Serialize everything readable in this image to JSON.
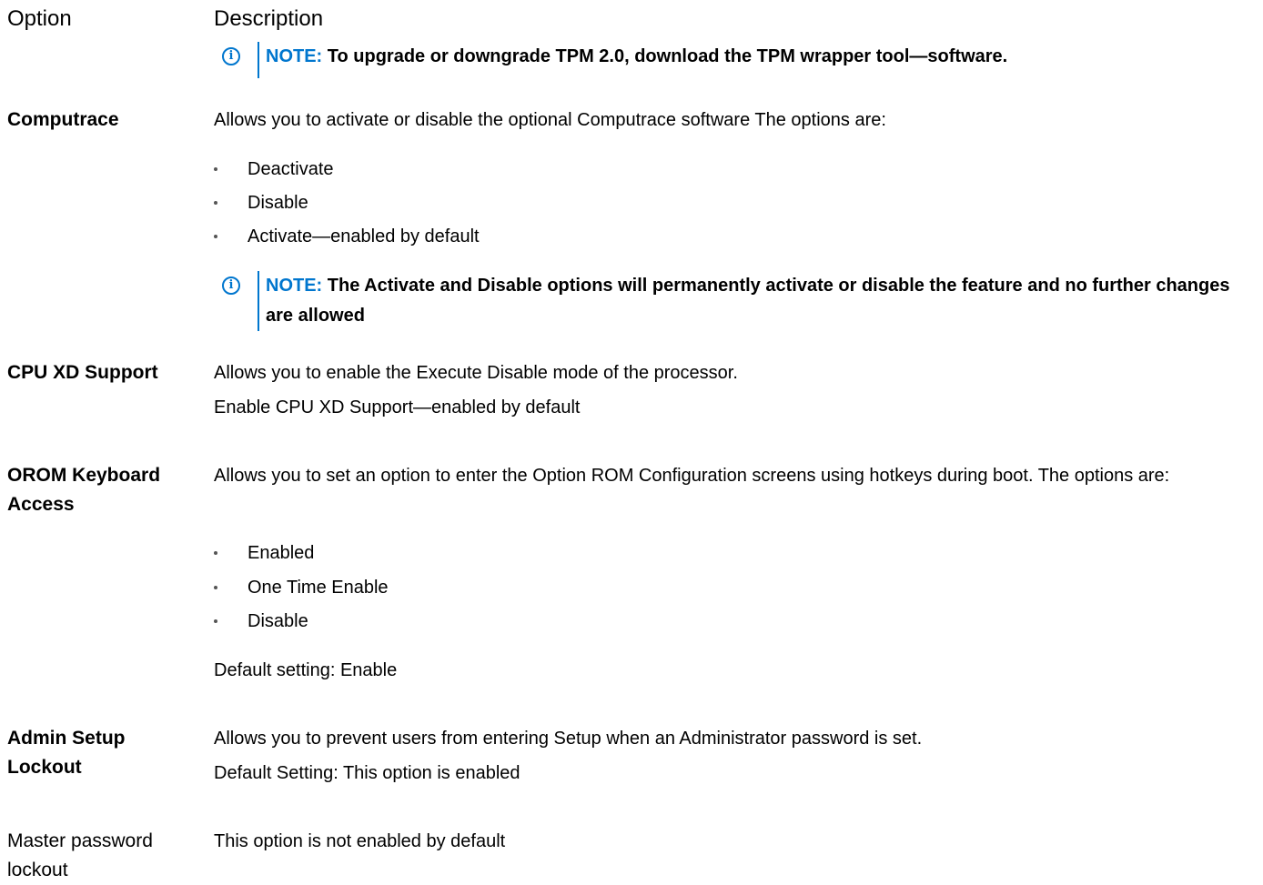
{
  "header": {
    "option": "Option",
    "description": "Description"
  },
  "note_tpm": {
    "label": "NOTE:",
    "text": " To upgrade or downgrade TPM 2.0, download the TPM wrapper tool—software."
  },
  "rows": [
    {
      "option": "Computrace",
      "intro": "Allows you to activate or disable the optional Computrace software The options are:",
      "items": [
        "Deactivate",
        "Disable",
        "Activate—enabled by default"
      ],
      "note": {
        "label": "NOTE:",
        "text": " The Activate and Disable options will permanently activate or disable the feature and no further changes are allowed"
      }
    },
    {
      "option": "CPU XD Support",
      "lines": [
        "Allows you to enable the Execute Disable mode of the processor.",
        "Enable CPU XD Support—enabled by default"
      ]
    },
    {
      "option": "OROM Keyboard Access",
      "intro": "Allows you to set an option to enter the Option ROM Configuration screens using hotkeys during boot. The options are:",
      "items": [
        "Enabled",
        "One Time Enable",
        "Disable"
      ],
      "default": "Default setting: Enable"
    },
    {
      "option": "Admin Setup Lockout",
      "lines": [
        "Allows you to prevent users from entering Setup when an Administrator password is set.",
        "Default Setting: This option is enabled"
      ]
    },
    {
      "option": "Master password lockout",
      "lines": [
        "This option is not enabled by default"
      ]
    }
  ],
  "colors": {
    "accent": "#0076ce",
    "text": "#000000"
  },
  "icons": {
    "note": "info-icon"
  }
}
